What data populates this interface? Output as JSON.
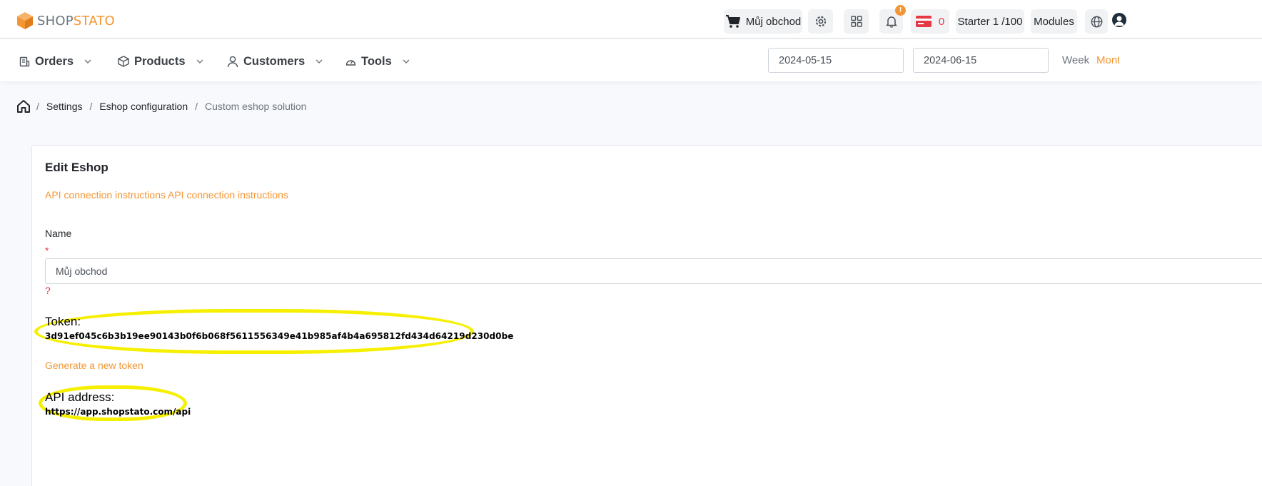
{
  "brand": {
    "part1": "SHOP",
    "part2": "STATO",
    "accent": "#f39633"
  },
  "header": {
    "shop_button": "Můj obchod",
    "notification_badge": "!",
    "credit_count": "0",
    "plan": "Starter 1 /100",
    "modules": "Modules"
  },
  "nav": {
    "items": [
      {
        "label": "Orders",
        "icon": "orders-icon"
      },
      {
        "label": "Products",
        "icon": "box-icon"
      },
      {
        "label": "Customers",
        "icon": "user-icon"
      },
      {
        "label": "Tools",
        "icon": "gauge-icon"
      }
    ],
    "date_from": "2024-05-15",
    "date_to": "2024-06-15",
    "period_week": "Week",
    "period_month": "Month"
  },
  "breadcrumb": {
    "settings": "Settings",
    "eshop_config": "Eshop configuration",
    "current": "Custom eshop solution"
  },
  "form": {
    "title": "Edit Eshop",
    "api_instructions": "API connection instructions API connection instructions",
    "name_label": "Name",
    "required_mark": "*",
    "name_value": "Můj obchod",
    "help_mark": "?",
    "token_label": "Token:",
    "token_value": "3d91ef045c6b3b19ee90143b0f6b068f5611556349e41b985af4b4a695812fd434d64219d230d0be",
    "generate_token": "Generate a new token",
    "api_label": "API address:",
    "api_value": "https://app.shopstato.com/api"
  },
  "colors": {
    "highlight": "#f6f000",
    "danger": "#dc3545",
    "credit": "#e53945"
  }
}
